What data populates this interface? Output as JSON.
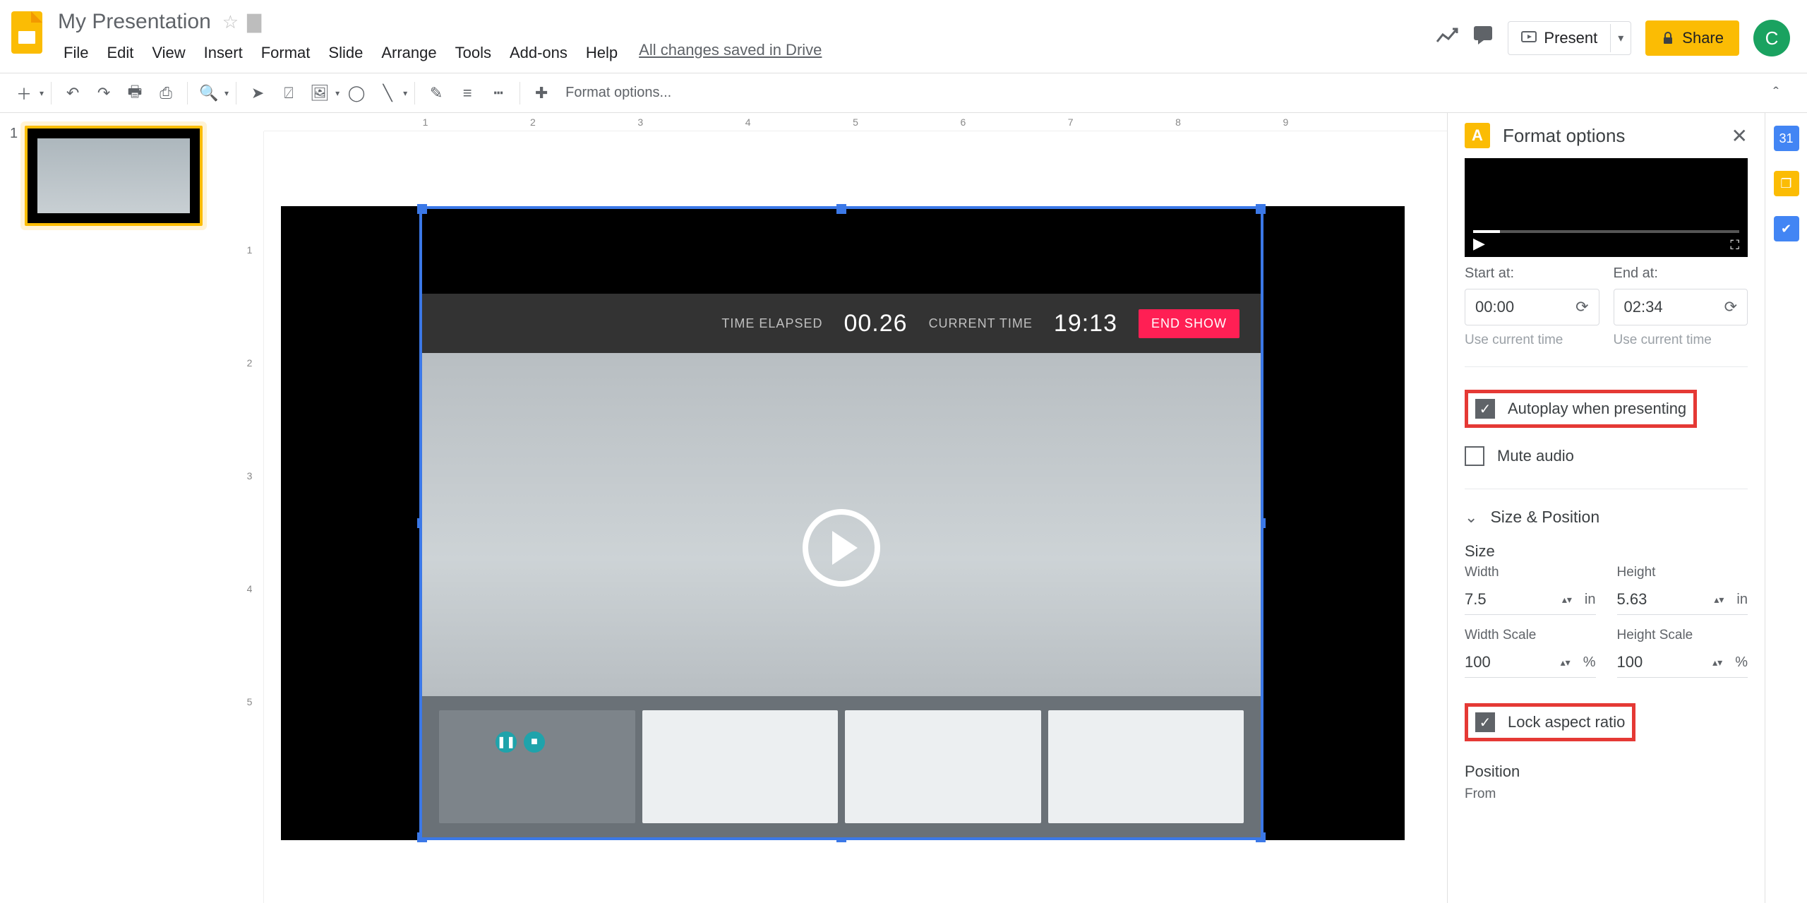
{
  "doc": {
    "title": "My Presentation",
    "saved": "All changes saved in Drive"
  },
  "menubar": [
    "File",
    "Edit",
    "View",
    "Insert",
    "Format",
    "Slide",
    "Arrange",
    "Tools",
    "Add-ons",
    "Help"
  ],
  "header": {
    "present": "Present",
    "share": "Share",
    "avatar": "C"
  },
  "toolbar": {
    "format_options": "Format options..."
  },
  "ruler": {
    "h": [
      "",
      "1",
      "2",
      "3",
      "4",
      "5",
      "6",
      "7",
      "8",
      "9",
      ""
    ],
    "v": [
      "1",
      "2",
      "3",
      "4",
      "5"
    ]
  },
  "thumb": {
    "num": "1"
  },
  "video": {
    "timeelapsed_label": "TIME ELAPSED",
    "timeelapsed": "00.26",
    "current_label": "CURRENT TIME",
    "current": "19:13",
    "end": "END SHOW"
  },
  "fmt": {
    "title": "Format options",
    "start_label": "Start at:",
    "end_label": "End at:",
    "start": "00:00",
    "end": "02:34",
    "hint": "Use current time",
    "autoplay": "Autoplay when presenting",
    "mute": "Mute audio",
    "sizepos": "Size & Position",
    "size": "Size",
    "width_label": "Width",
    "height_label": "Height",
    "width": "7.5",
    "height": "5.63",
    "in": "in",
    "wscale_label": "Width Scale",
    "hscale_label": "Height Scale",
    "wscale": "100",
    "hscale": "100",
    "pct": "%",
    "lock": "Lock aspect ratio",
    "position": "Position",
    "from": "From"
  }
}
